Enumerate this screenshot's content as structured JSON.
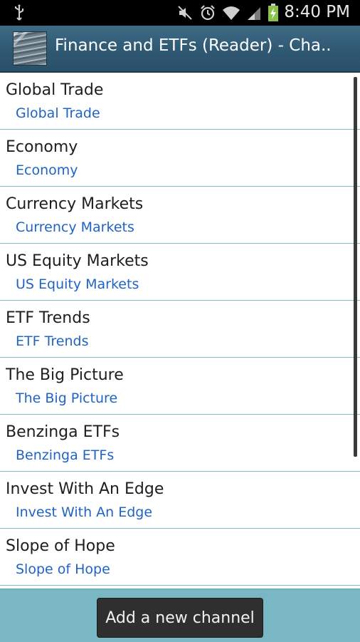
{
  "status_bar": {
    "time": "8:40 PM",
    "icons": [
      "usb-icon",
      "mute-icon",
      "alarm-icon",
      "wifi-icon",
      "signal-icon",
      "battery-charging-icon"
    ]
  },
  "action_bar": {
    "title": "Finance and ETFs (Reader) - Cha..",
    "logo_icon": "app-logo"
  },
  "channels": [
    {
      "title": "Global Trade",
      "subtitle": "Global Trade"
    },
    {
      "title": "Economy",
      "subtitle": "Economy"
    },
    {
      "title": "Currency Markets",
      "subtitle": "Currency Markets"
    },
    {
      "title": "US Equity Markets",
      "subtitle": "US Equity Markets"
    },
    {
      "title": "ETF Trends",
      "subtitle": "ETF Trends"
    },
    {
      "title": "The Big Picture",
      "subtitle": "The Big Picture"
    },
    {
      "title": "Benzinga ETFs",
      "subtitle": "Benzinga ETFs"
    },
    {
      "title": "Invest With An Edge",
      "subtitle": "Invest With An Edge"
    },
    {
      "title": "Slope of Hope",
      "subtitle": "Slope of Hope"
    }
  ],
  "bottom_bar": {
    "add_button_label": "Add a new channel"
  },
  "colors": {
    "action_bar": "#2f5872",
    "link_blue": "#1f63c5",
    "bottom_bar": "#7ab7c4",
    "divider": "#8bb6c9"
  }
}
